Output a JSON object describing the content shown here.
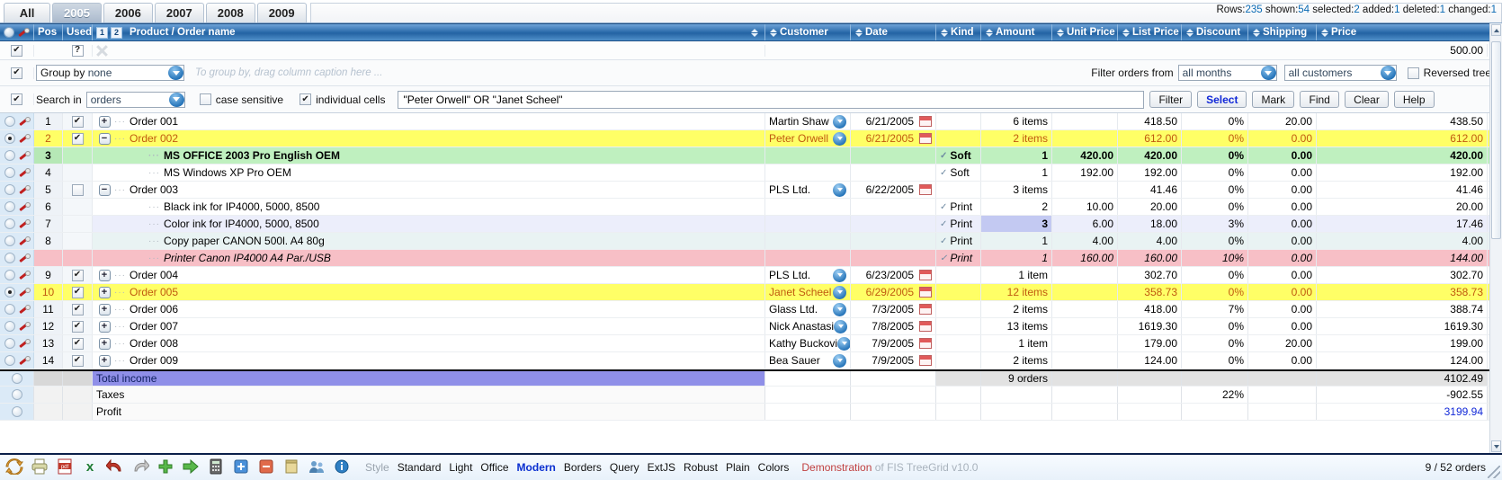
{
  "tabs": [
    {
      "label": "All",
      "active": false
    },
    {
      "label": "2005",
      "active": true
    },
    {
      "label": "2006",
      "active": false
    },
    {
      "label": "2007",
      "active": false
    },
    {
      "label": "2008",
      "active": false
    },
    {
      "label": "2009",
      "active": false
    }
  ],
  "status": {
    "rows_label": "Rows:",
    "rows_value": "235",
    "shown_label": "shown:",
    "shown_value": "54",
    "selected_label": "selected:",
    "selected_value": "2",
    "added_label": "added:",
    "added_value": "1",
    "deleted_label": "deleted:",
    "deleted_value": "1",
    "changed_label": "changed:",
    "changed_value": "1"
  },
  "columns": [
    {
      "label": "Pos"
    },
    {
      "label": "Used"
    },
    {
      "label": "Product / Order name"
    },
    {
      "label": "Customer"
    },
    {
      "label": "Date"
    },
    {
      "label": "Kind"
    },
    {
      "label": "Amount"
    },
    {
      "label": "Unit Price"
    },
    {
      "label": "List Price"
    },
    {
      "label": "Discount"
    },
    {
      "label": "Shipping"
    },
    {
      "label": "Price"
    }
  ],
  "header_badges": [
    "1",
    "2"
  ],
  "filter_row": {
    "price_value": "500.00"
  },
  "group_row": {
    "label": "Group by",
    "value": "none",
    "hint": "To group by, drag column caption here ..."
  },
  "filter_orders": {
    "label": "Filter orders from",
    "months_value": "all months",
    "customers_value": "all customers",
    "reversed_tree_label": "Reversed tree"
  },
  "search_row": {
    "label": "Search in",
    "scope_value": "orders",
    "case_sensitive_label": "case sensitive",
    "individual_cells_label": "individual cells",
    "query": "\"Peter Orwell\" OR \"Janet Scheel\"",
    "buttons": [
      "Filter",
      "Select",
      "Mark",
      "Find",
      "Clear",
      "Help"
    ],
    "active_button": "Select"
  },
  "rows": [
    {
      "pos": "1",
      "used": "checked",
      "tree": "plus",
      "name": "Order 001",
      "indent": 0,
      "customer": "Martin Shaw",
      "date": "6/21/2005",
      "kind": "",
      "amount": "6 items",
      "unit_price": "",
      "list_price": "418.50",
      "discount": "0%",
      "shipping": "20.00",
      "price": "438.50",
      "state": "normal",
      "radio": false
    },
    {
      "pos": "2",
      "used": "checked",
      "tree": "minus",
      "name": "Order 002",
      "indent": 0,
      "customer": "Peter Orwell",
      "date": "6/21/2005",
      "kind": "",
      "amount": "2 items",
      "unit_price": "",
      "list_price": "612.00",
      "discount": "0%",
      "shipping": "0.00",
      "price": "612.00",
      "state": "selected",
      "radio": true
    },
    {
      "pos": "3",
      "used": "",
      "tree": "leaf",
      "name": "MS OFFICE 2003 Pro English OEM",
      "indent": 1,
      "customer": "",
      "date": "",
      "kind": "Soft",
      "amount": "1",
      "unit_price": "420.00",
      "list_price": "420.00",
      "discount": "0%",
      "shipping": "0.00",
      "price": "420.00",
      "state": "added",
      "radio": false
    },
    {
      "pos": "4",
      "used": "",
      "tree": "leaf",
      "name": "MS Windows XP Pro OEM",
      "indent": 1,
      "customer": "",
      "date": "",
      "kind": "Soft",
      "amount": "1",
      "unit_price": "192.00",
      "list_price": "192.00",
      "discount": "0%",
      "shipping": "0.00",
      "price": "192.00",
      "state": "normal",
      "radio": false
    },
    {
      "pos": "5",
      "used": "empty",
      "tree": "minus",
      "name": "Order 003",
      "indent": 0,
      "customer": "PLS Ltd.",
      "date": "6/22/2005",
      "kind": "",
      "amount": "3 items",
      "unit_price": "",
      "list_price": "41.46",
      "discount": "0%",
      "shipping": "0.00",
      "price": "41.46",
      "state": "normal",
      "radio": false
    },
    {
      "pos": "6",
      "used": "",
      "tree": "leaf",
      "name": "Black ink for IP4000, 5000, 8500",
      "indent": 1,
      "customer": "",
      "date": "",
      "kind": "Print",
      "amount": "2",
      "unit_price": "10.00",
      "list_price": "20.00",
      "discount": "0%",
      "shipping": "0.00",
      "price": "20.00",
      "state": "normal",
      "radio": false
    },
    {
      "pos": "7",
      "used": "",
      "tree": "leaf",
      "name": "Color ink for IP4000, 5000, 8500",
      "indent": 1,
      "customer": "",
      "date": "",
      "kind": "Print",
      "amount": "3",
      "unit_price": "6.00",
      "list_price": "18.00",
      "discount": "3%",
      "shipping": "0.00",
      "price": "17.46",
      "state": "changed",
      "radio": false
    },
    {
      "pos": "8",
      "used": "",
      "tree": "leaf",
      "name": "Copy paper CANON 500l. A4 80g",
      "indent": 1,
      "customer": "",
      "date": "",
      "kind": "Print",
      "amount": "1",
      "unit_price": "4.00",
      "list_price": "4.00",
      "discount": "0%",
      "shipping": "0.00",
      "price": "4.00",
      "state": "normal",
      "radio": false
    },
    {
      "pos": "",
      "used": "",
      "tree": "leaf",
      "name": "Printer Canon IP4000 A4 Par./USB",
      "indent": 1,
      "customer": "",
      "date": "",
      "kind": "Print",
      "amount": "1",
      "unit_price": "160.00",
      "list_price": "160.00",
      "discount": "10%",
      "shipping": "0.00",
      "price": "144.00",
      "state": "deleted",
      "radio": false
    },
    {
      "pos": "9",
      "used": "checked",
      "tree": "plus",
      "name": "Order 004",
      "indent": 0,
      "customer": "PLS Ltd.",
      "date": "6/23/2005",
      "kind": "",
      "amount": "1 item",
      "unit_price": "",
      "list_price": "302.70",
      "discount": "0%",
      "shipping": "0.00",
      "price": "302.70",
      "state": "normal",
      "radio": false
    },
    {
      "pos": "10",
      "used": "checked",
      "tree": "plus",
      "name": "Order 005",
      "indent": 0,
      "customer": "Janet Scheel",
      "date": "6/29/2005",
      "kind": "",
      "amount": "12 items",
      "unit_price": "",
      "list_price": "358.73",
      "discount": "0%",
      "shipping": "0.00",
      "price": "358.73",
      "state": "selected",
      "radio": true
    },
    {
      "pos": "11",
      "used": "checked",
      "tree": "plus",
      "name": "Order 006",
      "indent": 0,
      "customer": "Glass Ltd.",
      "date": "7/3/2005",
      "kind": "",
      "amount": "2 items",
      "unit_price": "",
      "list_price": "418.00",
      "discount": "7%",
      "shipping": "0.00",
      "price": "388.74",
      "state": "normal",
      "radio": false
    },
    {
      "pos": "12",
      "used": "checked",
      "tree": "plus",
      "name": "Order 007",
      "indent": 0,
      "customer": "Nick Anastasi",
      "date": "7/8/2005",
      "kind": "",
      "amount": "13 items",
      "unit_price": "",
      "list_price": "1619.30",
      "discount": "0%",
      "shipping": "0.00",
      "price": "1619.30",
      "state": "normal",
      "radio": false
    },
    {
      "pos": "13",
      "used": "checked",
      "tree": "plus",
      "name": "Order 008",
      "indent": 0,
      "customer": "Kathy Buckovi",
      "date": "7/9/2005",
      "kind": "",
      "amount": "1 item",
      "unit_price": "",
      "list_price": "179.00",
      "discount": "0%",
      "shipping": "20.00",
      "price": "199.00",
      "state": "normal",
      "radio": false
    },
    {
      "pos": "14",
      "used": "checked",
      "tree": "plus",
      "name": "Order 009",
      "indent": 0,
      "customer": "Bea Sauer",
      "date": "7/9/2005",
      "kind": "",
      "amount": "2 items",
      "unit_price": "",
      "list_price": "124.00",
      "discount": "0%",
      "shipping": "0.00",
      "price": "124.00",
      "state": "normal",
      "radio": false
    }
  ],
  "footer": [
    {
      "name": "Total income",
      "amount": "9 orders",
      "discount": "",
      "price": "4102.49",
      "highlight": true
    },
    {
      "name": "Taxes",
      "amount": "",
      "discount": "22%",
      "price": "-902.55",
      "highlight": false
    },
    {
      "name": "Profit",
      "amount": "",
      "discount": "",
      "price": "3199.94",
      "highlight": false
    }
  ],
  "bottombar": {
    "icons": [
      "refresh-icon",
      "print-icon",
      "pdf-icon",
      "excel-icon",
      "undo-icon",
      "redo-icon",
      "add-icon",
      "add-child-icon",
      "calculator-icon",
      "expand-all-icon",
      "collapse-all-icon",
      "column-icon",
      "users-icon",
      "info-icon"
    ],
    "style_label": "Style",
    "styles": [
      "Standard",
      "Light",
      "Office",
      "Modern",
      "Borders",
      "Query",
      "ExtJS",
      "Robust",
      "Plain",
      "Colors"
    ],
    "current_style": "Modern",
    "demo_text": "Demonstration",
    "demo_sub": "of FIS TreeGrid v10.0",
    "order_count": "9 / 52 orders"
  }
}
